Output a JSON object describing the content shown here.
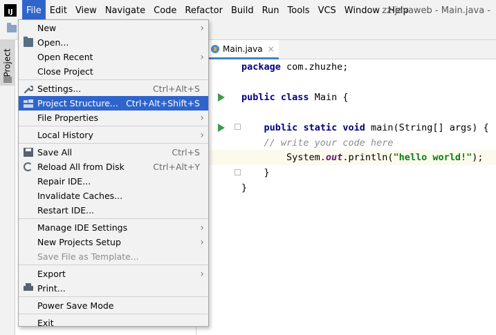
{
  "app": {
    "logo_text": "IJ",
    "window_title": "zz-javaweb - Main.java -"
  },
  "menubar": {
    "items": [
      "File",
      "Edit",
      "View",
      "Navigate",
      "Code",
      "Refactor",
      "Build",
      "Run",
      "Tools",
      "VCS",
      "Window",
      "Help"
    ]
  },
  "sidebar": {
    "project_tab_label": "Project"
  },
  "editor": {
    "tab_label": "Main.java",
    "close_glyph": "×",
    "code": {
      "line1_kw": "package",
      "line1_rest": " com.zhuzhe;",
      "line3_kw1": "public",
      "line3_kw2": "class",
      "line3_rest": " Main {",
      "line5_indent": "    ",
      "line5_kw1": "public",
      "line5_kw2": "static",
      "line5_kw3": "void",
      "line5_rest": " main(String[] args) {",
      "line6_comment": "    // write your code here",
      "line7_pre": "        System.",
      "line7_field": "out",
      "line7_mid": ".println(",
      "line7_str": "\"hello world!\"",
      "line7_end": ");",
      "line8": "    }",
      "line9": "}"
    }
  },
  "file_menu": {
    "items": [
      {
        "label": "New",
        "shortcut": "",
        "submenu": true,
        "icon": "",
        "selected": false,
        "disabled": false
      },
      {
        "label": "Open...",
        "shortcut": "",
        "submenu": false,
        "icon": "folder-open-icon",
        "selected": false,
        "disabled": false
      },
      {
        "label": "Open Recent",
        "shortcut": "",
        "submenu": true,
        "icon": "",
        "selected": false,
        "disabled": false
      },
      {
        "label": "Close Project",
        "shortcut": "",
        "submenu": false,
        "icon": "",
        "selected": false,
        "disabled": false
      },
      {
        "label": "Settings...",
        "shortcut": "Ctrl+Alt+S",
        "submenu": false,
        "icon": "wrench-icon",
        "selected": false,
        "disabled": false
      },
      {
        "label": "Project Structure...",
        "shortcut": "Ctrl+Alt+Shift+S",
        "submenu": false,
        "icon": "project-structure-icon",
        "selected": true,
        "disabled": false
      },
      {
        "label": "File Properties",
        "shortcut": "",
        "submenu": true,
        "icon": "",
        "selected": false,
        "disabled": false
      },
      {
        "label": "Local History",
        "shortcut": "",
        "submenu": true,
        "icon": "",
        "selected": false,
        "disabled": false
      },
      {
        "label": "Save All",
        "shortcut": "Ctrl+S",
        "submenu": false,
        "icon": "save-icon",
        "selected": false,
        "disabled": false
      },
      {
        "label": "Reload All from Disk",
        "shortcut": "Ctrl+Alt+Y",
        "submenu": false,
        "icon": "reload-icon",
        "selected": false,
        "disabled": false
      },
      {
        "label": "Repair IDE...",
        "shortcut": "",
        "submenu": false,
        "icon": "",
        "selected": false,
        "disabled": false
      },
      {
        "label": "Invalidate Caches...",
        "shortcut": "",
        "submenu": false,
        "icon": "",
        "selected": false,
        "disabled": false
      },
      {
        "label": "Restart IDE...",
        "shortcut": "",
        "submenu": false,
        "icon": "",
        "selected": false,
        "disabled": false
      },
      {
        "label": "Manage IDE Settings",
        "shortcut": "",
        "submenu": true,
        "icon": "",
        "selected": false,
        "disabled": false
      },
      {
        "label": "New Projects Setup",
        "shortcut": "",
        "submenu": true,
        "icon": "",
        "selected": false,
        "disabled": false
      },
      {
        "label": "Save File as Template...",
        "shortcut": "",
        "submenu": false,
        "icon": "",
        "selected": false,
        "disabled": true
      },
      {
        "label": "Export",
        "shortcut": "",
        "submenu": true,
        "icon": "",
        "selected": false,
        "disabled": false
      },
      {
        "label": "Print...",
        "shortcut": "",
        "submenu": false,
        "icon": "print-icon",
        "selected": false,
        "disabled": false
      },
      {
        "label": "Power Save Mode",
        "shortcut": "",
        "submenu": false,
        "icon": "",
        "selected": false,
        "disabled": false
      },
      {
        "label": "Exit",
        "shortcut": "",
        "submenu": false,
        "icon": "",
        "selected": false,
        "disabled": false
      }
    ],
    "submenu_glyph": "›"
  },
  "colors": {
    "selection": "#2f65ca",
    "keyword": "#000080",
    "string": "#067d17",
    "comment": "#8c8c8c",
    "run_icon": "#3c9b49"
  }
}
